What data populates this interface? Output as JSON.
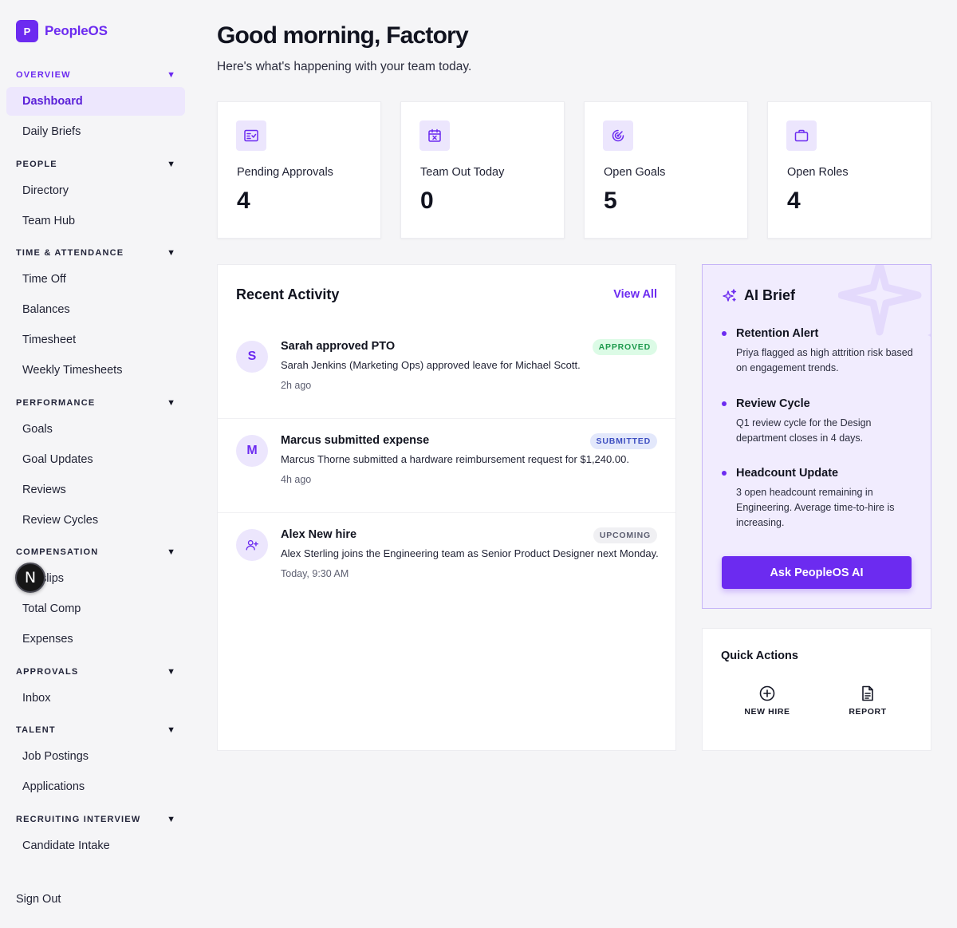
{
  "brand": {
    "mark": "P",
    "name": "PeopleOS"
  },
  "sidebar": {
    "sections": [
      {
        "label": "OVERVIEW",
        "caret": "▼",
        "items": [
          "Dashboard",
          "Daily Briefs"
        ]
      },
      {
        "label": "PEOPLE",
        "caret": "▼",
        "items": [
          "Directory",
          "Team Hub"
        ]
      },
      {
        "label": "TIME & ATTENDANCE",
        "caret": "▼",
        "items": [
          "Time Off",
          "Balances",
          "Timesheet",
          "Weekly Timesheets"
        ]
      },
      {
        "label": "PERFORMANCE",
        "caret": "▼",
        "items": [
          "Goals",
          "Goal Updates",
          "Reviews",
          "Review Cycles"
        ]
      },
      {
        "label": "COMPENSATION",
        "caret": "▼",
        "items": [
          "slips",
          "Total Comp",
          "Expenses"
        ]
      },
      {
        "label": "APPROVALS",
        "caret": "▼",
        "items": [
          "Inbox"
        ]
      },
      {
        "label": "TALENT",
        "caret": "▼",
        "items": [
          "Job Postings",
          "Applications"
        ]
      },
      {
        "label": "RECRUITING INTERVIEW",
        "caret": "▼",
        "items": [
          "Candidate Intake"
        ]
      }
    ],
    "active_item": "Dashboard",
    "sign_out": "Sign Out",
    "overlay_badge": "N"
  },
  "greeting": {
    "title": "Good morning, Factory",
    "subtitle": "Here's what's happening with your team today."
  },
  "stats": [
    {
      "label": "Pending Approvals",
      "value": "4",
      "icon": "approvals-icon"
    },
    {
      "label": "Team Out Today",
      "value": "0",
      "icon": "calendar-x-icon"
    },
    {
      "label": "Open Goals",
      "value": "5",
      "icon": "target-icon"
    },
    {
      "label": "Open Roles",
      "value": "4",
      "icon": "briefcase-icon"
    }
  ],
  "activity": {
    "title": "Recent Activity",
    "view_all": "View All",
    "items": [
      {
        "avatar": "S",
        "title": "Sarah approved PTO",
        "description": "Sarah Jenkins (Marketing Ops) approved leave for Michael Scott.",
        "time": "2h ago",
        "badge": "APPROVED"
      },
      {
        "avatar": "M",
        "title": "Marcus submitted expense",
        "description": "Marcus Thorne submitted a hardware reimbursement request for $1,240.00.",
        "time": "4h ago",
        "badge": "SUBMITTED"
      },
      {
        "avatar": "",
        "title": "Alex New hire",
        "description": "Alex Sterling joins the Engineering team as Senior Product Designer next Monday.",
        "time": "Today, 9:30 AM",
        "badge": "UPCOMING"
      }
    ]
  },
  "ai_brief": {
    "title": "AI Brief",
    "items": [
      {
        "title": "Retention Alert",
        "description": "Priya flagged as high attrition risk based on engagement trends."
      },
      {
        "title": "Review Cycle",
        "description": "Q1 review cycle for the Design department closes in 4 days."
      },
      {
        "title": "Headcount Update",
        "description": "3 open headcount remaining in Engineering. Average time-to-hire is increasing."
      }
    ],
    "button": "Ask PeopleOS AI"
  },
  "quick_actions": {
    "title": "Quick Actions",
    "items": [
      {
        "label": "NEW HIRE",
        "icon": "plus-circle-icon"
      },
      {
        "label": "REPORT",
        "icon": "document-icon"
      }
    ]
  },
  "colors": {
    "accent": "#6c2bf0",
    "accent_soft": "#ece6fd",
    "background": "#f5f5f7"
  }
}
